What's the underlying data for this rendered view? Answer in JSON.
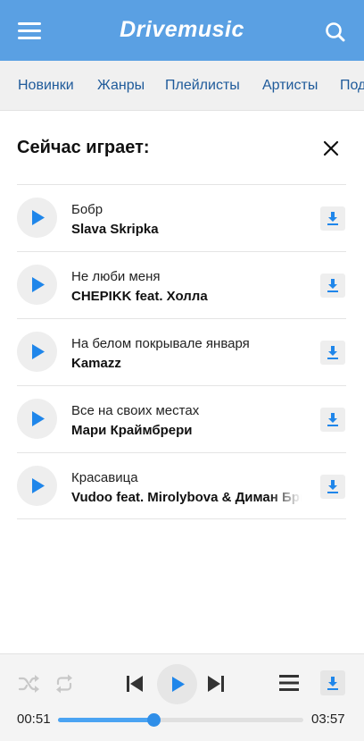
{
  "header": {
    "logo": "Drivemusic",
    "menu_icon": "menu-icon",
    "search_icon": "search-icon",
    "bg_color": "#5aa0e3"
  },
  "nav": {
    "items": [
      "Новинки",
      "Жанры",
      "Плейлисты",
      "Артисты",
      "Под"
    ]
  },
  "now_playing": {
    "title": "Сейчас играет:",
    "close_icon": "close-icon",
    "tracks": [
      {
        "name": "Бобр",
        "artist": "Slava Skripka"
      },
      {
        "name": "Не люби меня",
        "artist": "CHEPIKK feat. Холла"
      },
      {
        "name": "На белом покрывале января",
        "artist": "Kamazz"
      },
      {
        "name": "Все на своих местах",
        "artist": "Мари Краймбрери"
      },
      {
        "name": "Красавица",
        "artist": "Vudoo feat. Mirolybova & Диман Брюханов"
      }
    ]
  },
  "player": {
    "current_time": "00:51",
    "total_time": "03:57",
    "progress": 0.39,
    "accent": "#2f8ee8"
  }
}
